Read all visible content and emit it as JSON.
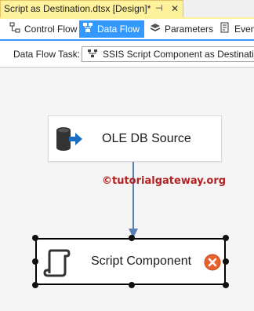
{
  "document_tab": {
    "title": "Script as Destination.dtsx [Design]*",
    "pin_glyph": "⊣",
    "close_glyph": "✕"
  },
  "designer_tabs": [
    {
      "label": "Control Flow",
      "icon": "control-flow-icon",
      "active": false
    },
    {
      "label": "Data Flow",
      "icon": "data-flow-icon",
      "active": true
    },
    {
      "label": "Parameters",
      "icon": "parameters-icon",
      "active": false
    },
    {
      "label": "Even",
      "icon": "event-handlers-icon",
      "active": false
    }
  ],
  "task_bar": {
    "label": "Data Flow Task:",
    "selected_task": "SSIS Script Component as Destination",
    "icon": "data-flow-task-icon"
  },
  "canvas": {
    "source_component": {
      "label": "OLE DB Source",
      "icon": "ole-db-source-icon"
    },
    "destination_component": {
      "label": "Script Component",
      "icon": "script-component-icon",
      "status_icon": "error-icon",
      "selected": true
    },
    "watermark": "©tutorialgateway.org"
  },
  "colors": {
    "tab_active_yellow": "#fff29d",
    "designer_active_blue": "#3399ff",
    "connector_blue": "#5b7fb2",
    "error_orange": "#e8612c",
    "watermark_red": "#b22222"
  }
}
